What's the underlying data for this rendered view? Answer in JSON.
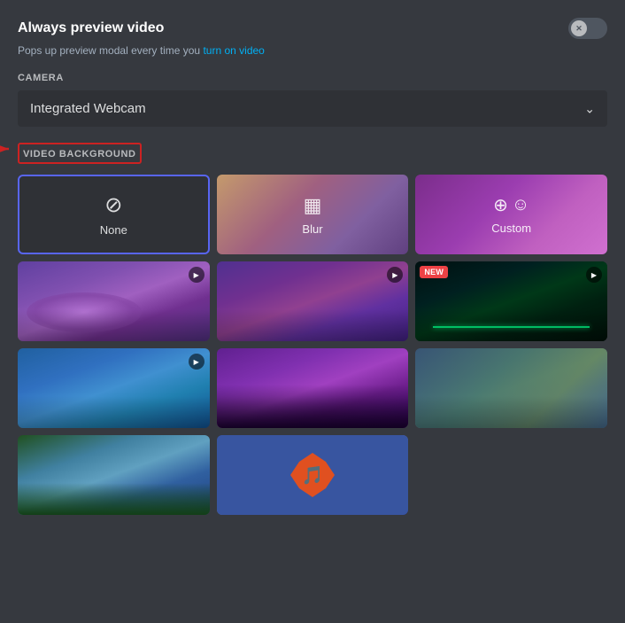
{
  "header": {
    "title": "Always preview video",
    "subtitle": "Pops up preview modal every time you",
    "subtitle_link": "turn on video",
    "toggle_state": "off"
  },
  "camera": {
    "label": "CAMERA",
    "selected": "Integrated Webcam",
    "options": [
      "Integrated Webcam"
    ]
  },
  "video_background": {
    "label": "VIDEO BACKGROUND",
    "items": [
      {
        "id": "none",
        "label": "None",
        "type": "none",
        "selected": true
      },
      {
        "id": "blur",
        "label": "Blur",
        "type": "blur"
      },
      {
        "id": "custom",
        "label": "Custom",
        "type": "custom"
      },
      {
        "id": "thumb1",
        "label": "",
        "type": "video",
        "has_play": true
      },
      {
        "id": "thumb2",
        "label": "",
        "type": "video",
        "has_play": true
      },
      {
        "id": "thumb3",
        "label": "",
        "type": "video",
        "has_play": true,
        "has_new": true
      },
      {
        "id": "thumb4",
        "label": "",
        "type": "video",
        "has_play": true
      },
      {
        "id": "thumb5",
        "label": "",
        "type": "video"
      },
      {
        "id": "thumb6",
        "label": "",
        "type": "video"
      },
      {
        "id": "thumb7",
        "label": "",
        "type": "video"
      },
      {
        "id": "thumb8",
        "label": "",
        "type": "video"
      }
    ]
  },
  "icons": {
    "none": "⊘",
    "blur": "▦",
    "custom_upload": "⊕",
    "custom_face": "☺",
    "play": "▶",
    "chevron_down": "⌄",
    "close": "✕",
    "new_badge": "NEW"
  }
}
